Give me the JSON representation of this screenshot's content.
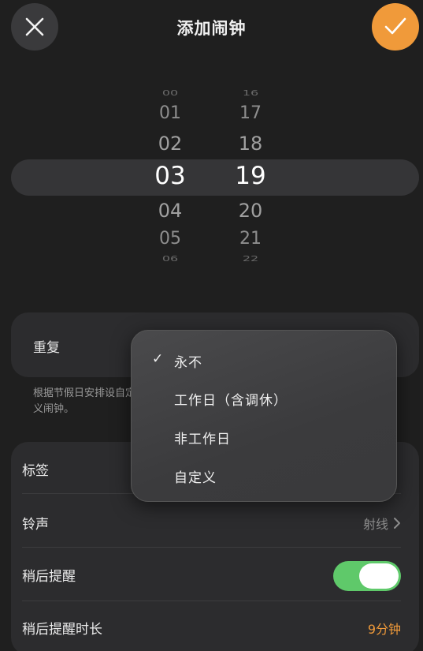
{
  "header": {
    "title": "添加闹钟",
    "close_icon": "close-icon",
    "confirm_icon": "checkmark-icon",
    "accent": "#f09a3a"
  },
  "picker": {
    "hours": [
      "00",
      "01",
      "02",
      "03",
      "04",
      "05",
      "06"
    ],
    "minutes": [
      "16",
      "17",
      "18",
      "19",
      "20",
      "21",
      "22"
    ],
    "selected_hour": "03",
    "selected_minute": "19"
  },
  "repeat": {
    "label": "重复",
    "hint": "根据节假日安排设自定义闹钟。"
  },
  "settings": {
    "label_row": {
      "label": "标签"
    },
    "ringtone_row": {
      "label": "铃声",
      "value": "射线"
    },
    "snooze_row": {
      "label": "稍后提醒",
      "on": true
    },
    "snooze_duration_row": {
      "label": "稍后提醒时长",
      "value": "9分钟"
    }
  },
  "repeat_menu": {
    "options": [
      "永不",
      "工作日（含调休）",
      "非工作日",
      "自定义"
    ],
    "selected_index": 0,
    "check_mark": "✓"
  }
}
